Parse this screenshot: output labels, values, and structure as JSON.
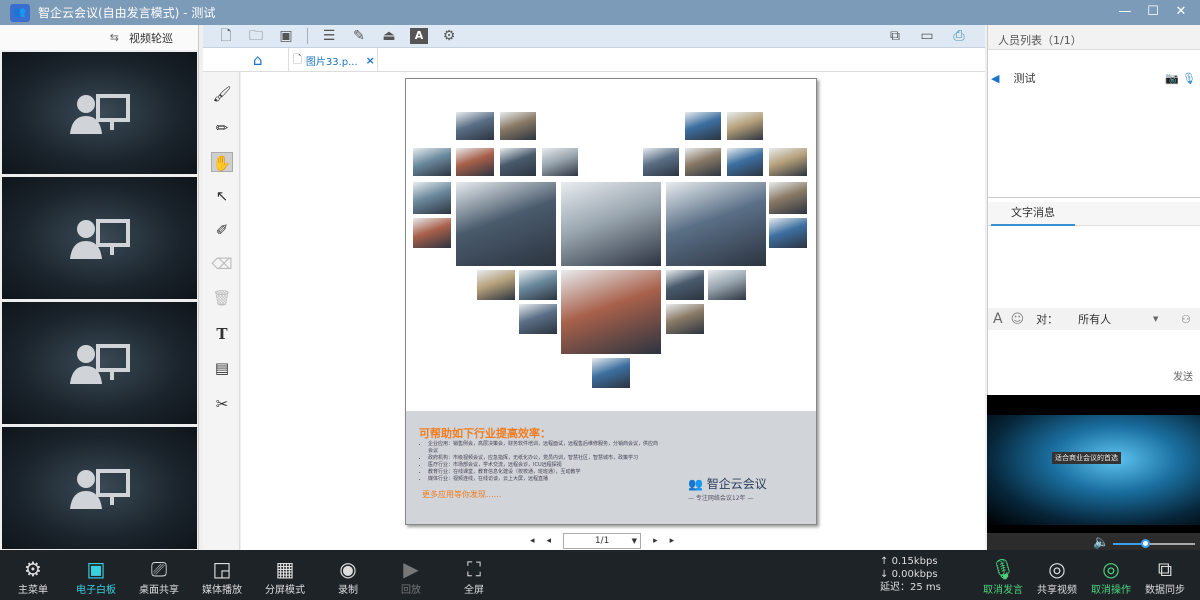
{
  "window": {
    "title": "智企云会议(自由发言模式) - 测试",
    "logo_icon": "app-logo-icon",
    "accent": "#7b9bb8"
  },
  "left_panel": {
    "header_label": "视频轮巡",
    "tiles": 4
  },
  "toolbar": {
    "icons": [
      "new-file-icon",
      "open-folder-icon",
      "save-icon",
      "list-icon",
      "edit-icon",
      "stamp-icon",
      "text-a-icon",
      "gear-icon"
    ],
    "right_icons": [
      "camera-icon",
      "window-icon",
      "print-icon"
    ]
  },
  "tabs": [
    {
      "label": "图片33.p...",
      "close": "×"
    }
  ],
  "tools": [
    "brush-icon",
    "pen-icon",
    "hand-icon",
    "pointer-icon",
    "highlighter-icon",
    "eraser-icon",
    "trash-icon",
    "text-icon",
    "image-icon",
    "scissors-icon"
  ],
  "page": {
    "heading": "可帮助如下行业提高效率：",
    "bullets": [
      "企业应用：销售例会，高层决策会，财务软件培训，远程面试，远程售后维修服务，分销商会议，供应商会议",
      "政府机构：市级视频会议，应急指挥，无纸化办公，党员内训，智慧社区，智慧城市，政策学习",
      "医疗行业：市场部会议，学术交流，远程会诊，ICU远程探视",
      "教育行业：在线课堂，教育信息化建设（校校通，班班通），互动教学",
      "媒体行业：视频连线，在线访谈，云上大屏，远程直播"
    ],
    "more": "更多应用等你发现......",
    "brand": "智企云会议",
    "brand_sub": "— 专注网络会议12年 —"
  },
  "pager": {
    "prev_first": "◂",
    "prev": "◂",
    "value": "1/1",
    "next": "▸",
    "last": "▸"
  },
  "participants": {
    "header": "人员列表（1/1）",
    "items": [
      {
        "name": "测试"
      }
    ]
  },
  "chat": {
    "tab": "文字消息",
    "font_label": "A",
    "to_label": "对：",
    "to_value": "所有人",
    "send": "发送"
  },
  "video": {
    "caption": "适合商业会议的首选"
  },
  "bottom": {
    "buttons": [
      {
        "label": "主菜单",
        "icon": "gear-icon"
      },
      {
        "label": "电子白板",
        "icon": "whiteboard-icon",
        "active": true
      },
      {
        "label": "桌面共享",
        "icon": "desktop-share-icon"
      },
      {
        "label": "媒体播放",
        "icon": "cast-icon"
      },
      {
        "label": "分屏模式",
        "icon": "layout-icon"
      },
      {
        "label": "录制",
        "icon": "record-icon"
      },
      {
        "label": "回放",
        "icon": "play-icon",
        "disabled": true
      },
      {
        "label": "全屏",
        "icon": "fullscreen-icon"
      }
    ],
    "stats": {
      "up": "0.15kbps",
      "down": "0.00kbps",
      "latency": "延迟：25 ms"
    },
    "right_buttons": [
      {
        "label": "取消发言",
        "icon": "microphone-icon",
        "green": true
      },
      {
        "label": "共享视频",
        "icon": "webcam-icon"
      },
      {
        "label": "取消操作",
        "icon": "operation-icon",
        "green": true
      },
      {
        "label": "数据同步",
        "icon": "sync-icon"
      }
    ]
  }
}
